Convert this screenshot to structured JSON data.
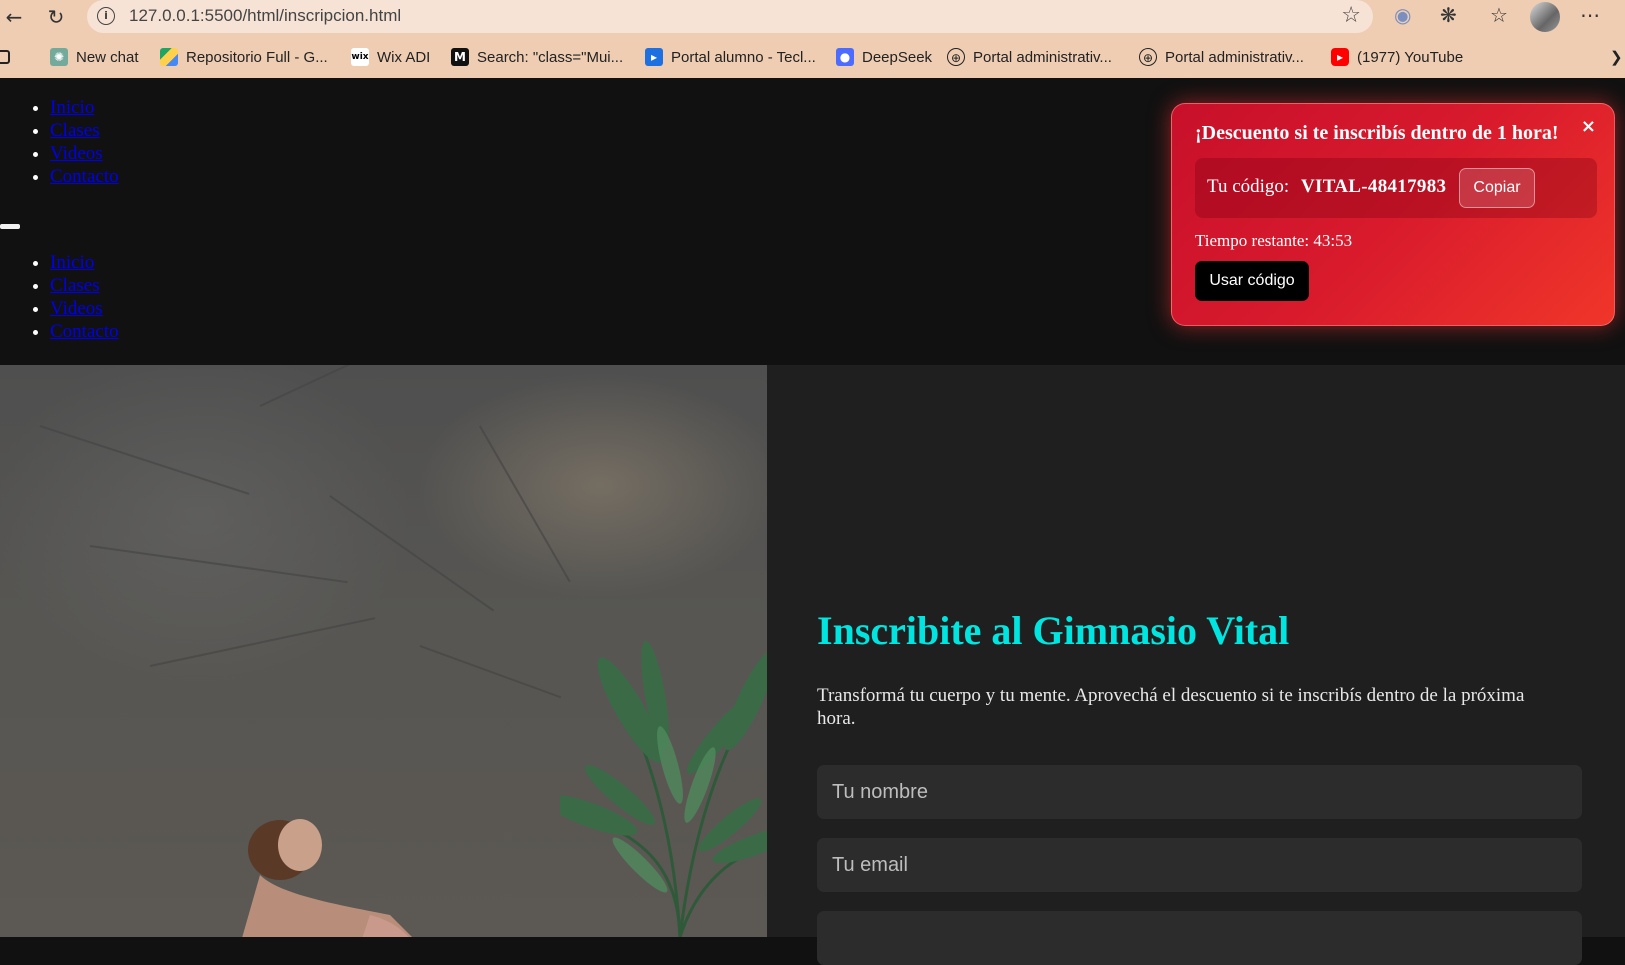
{
  "browser": {
    "url": "127.0.0.1:5500/html/inscripcion.html",
    "bookmarks": [
      {
        "label": "New chat",
        "icon": "chatgpt-icon"
      },
      {
        "label": "Repositorio Full - G...",
        "icon": "google-drive-icon"
      },
      {
        "label": "Wix ADI",
        "icon": "wix-icon"
      },
      {
        "label": "Search: \"class=\"Mui...",
        "icon": "mui-icon"
      },
      {
        "label": "Portal alumno - Tecl...",
        "icon": "portal-icon"
      },
      {
        "label": "DeepSeek",
        "icon": "deepseek-icon"
      },
      {
        "label": "Portal administrativ...",
        "icon": "globe-icon"
      },
      {
        "label": "Portal administrativ...",
        "icon": "globe-icon"
      },
      {
        "label": "(1977) YouTube",
        "icon": "youtube-icon"
      }
    ]
  },
  "nav": {
    "items": [
      "Inicio",
      "Clases",
      "Videos",
      "Contacto"
    ],
    "mobile_items": [
      "Inicio",
      "Clases",
      "Videos",
      "Contacto"
    ]
  },
  "hero": {
    "title": "Inscribite al Gimnasio Vital",
    "description": "Transformá tu cuerpo y tu mente. Aprovechá el descuento si te inscribís dentro de la próxima hora.",
    "fields": [
      {
        "placeholder": "Tu nombre"
      },
      {
        "placeholder": "Tu email"
      },
      {
        "placeholder": ""
      }
    ]
  },
  "popup": {
    "title": "¡Descuento si te inscribís dentro de 1 hora!",
    "close": "×",
    "code_label": "Tu código:",
    "code_value": "VITAL-48417983",
    "copy_label": "Copiar",
    "timer_label": "Tiempo restante:",
    "timer_value": "43:53",
    "use_label": "Usar código"
  },
  "colors": {
    "accent": "#00e5e0",
    "popup": "#d81a2c",
    "page_bg": "#111111"
  }
}
